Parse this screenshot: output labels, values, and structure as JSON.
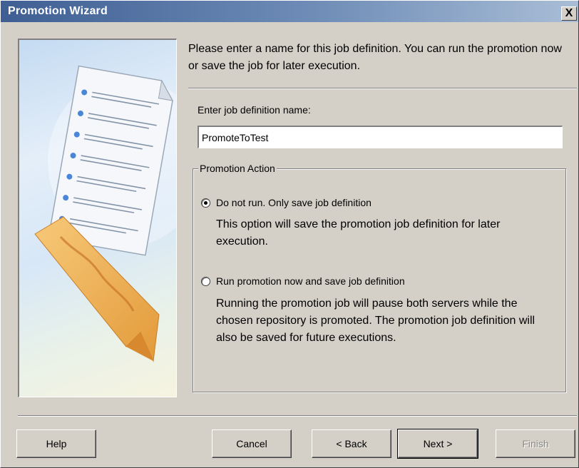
{
  "window": {
    "title": "Promotion Wizard",
    "close_label": "X"
  },
  "intro_text": "Please enter a name for this job definition. You can run the promotion now or save the job for later execution.",
  "job_name": {
    "label": "Enter job definition name:",
    "value": "PromoteToTest"
  },
  "promotion_action": {
    "legend": "Promotion Action",
    "options": [
      {
        "label": "Do not run. Only save job definition",
        "description": "This option will save the promotion job definition for later execution.",
        "selected": true
      },
      {
        "label": "Run promotion now and save job definition",
        "description": "Running the promotion job will pause both servers while the chosen repository is promoted. The promotion job definition will also be saved for future executions.",
        "selected": false
      }
    ]
  },
  "buttons": {
    "help": "Help",
    "cancel": "Cancel",
    "back": "< Back",
    "next": "Next >",
    "finish": "Finish"
  },
  "colors": {
    "title_bar": "#3f5f94",
    "dialog_bg": "#d4d0c8",
    "bookmark": "#f2b458"
  },
  "icons": {
    "close": "close-icon",
    "illustration": "document-with-bookmark-illustration"
  }
}
